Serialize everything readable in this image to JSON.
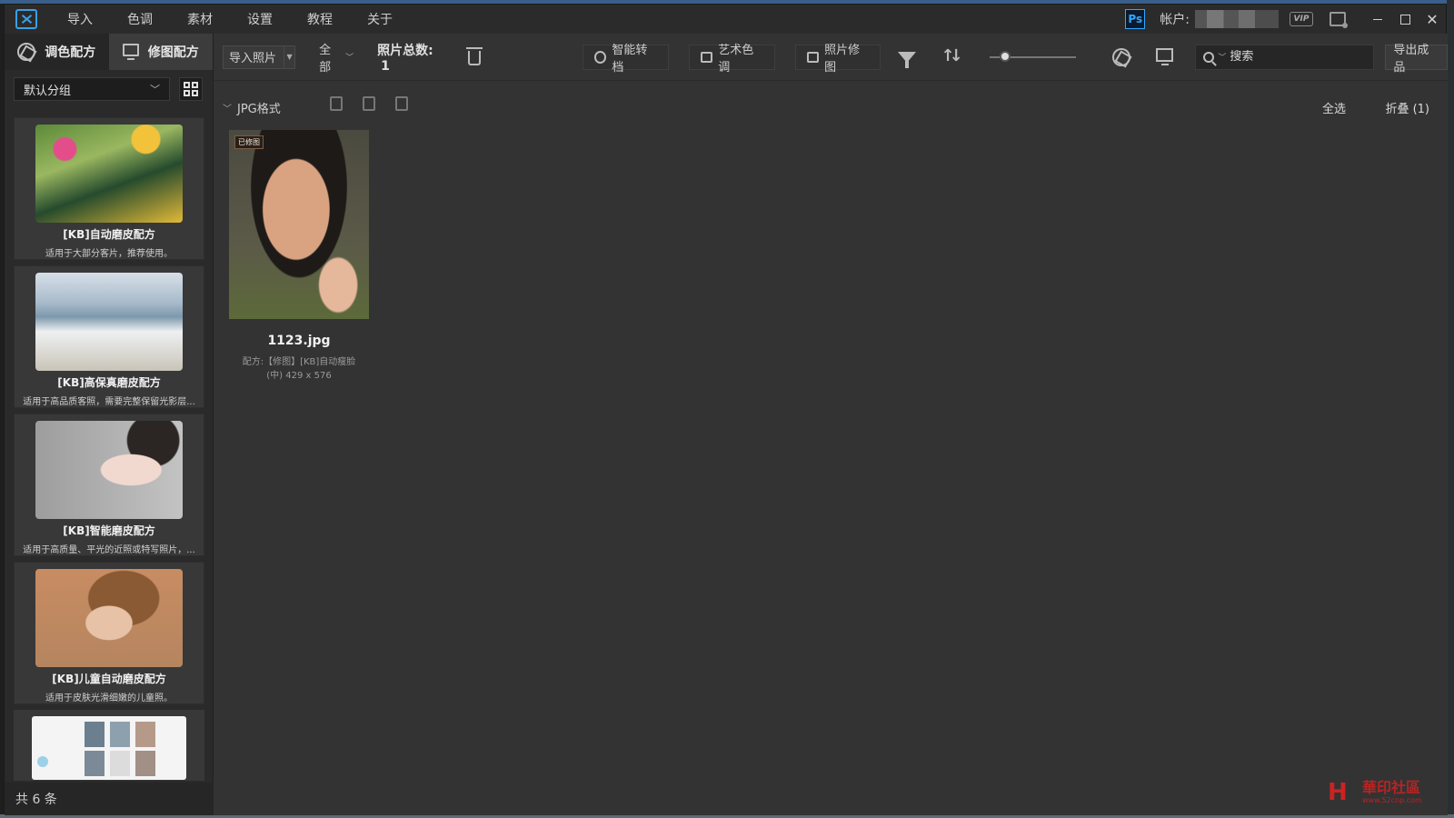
{
  "menu": [
    "导入",
    "色调",
    "素材",
    "设置",
    "教程",
    "关于"
  ],
  "titlebar": {
    "ps_label": "Ps",
    "account_label": "帐户:",
    "vip_label": "VIP"
  },
  "left_panel": {
    "tabs": [
      {
        "label": "调色配方",
        "icon": "aperture-icon"
      },
      {
        "label": "修图配方",
        "icon": "monitor-icon"
      }
    ],
    "group_select": "默认分组",
    "presets": [
      {
        "name": "[KB]自动磨皮配方",
        "desc": "适用于大部分客片，推荐使用。"
      },
      {
        "name": "[KB]高保真磨皮配方",
        "desc": "适用于高品质客照，需要完整保留光影层..."
      },
      {
        "name": "[KB]智能磨皮配方",
        "desc": "适用于高质量、平光的近照或特写照片，..."
      },
      {
        "name": "[KB]儿童自动磨皮配方",
        "desc": "适用于皮肤光滑细嫩的儿童照。"
      }
    ],
    "footer": "共 6 条"
  },
  "toolbar": {
    "import_label": "导入照片",
    "filter_all": "全部",
    "photo_total_label": "照片总数:",
    "photo_total": "1",
    "actions": [
      "智能转档",
      "艺术色调",
      "照片修图"
    ],
    "zoom_level": 0.12,
    "search_placeholder": "搜索",
    "export_label": "导出成品"
  },
  "main": {
    "group_title": "JPG格式",
    "select_all": "全选",
    "collapse": "折叠 (1)",
    "photo": {
      "badge": "已修图",
      "name": "1123.jpg",
      "meta_line1": "配方:【修图】[KB]自动瘦脸",
      "meta_line2": "(中)   429 x 576"
    }
  },
  "watermark": {
    "logo_char": "H",
    "text": "華印社區",
    "url": "www.52cnp.com"
  },
  "colors": {
    "window_bg": "#333333",
    "sidebar_bg": "#2a2a2a",
    "accent": "#3ba0e6",
    "ps_blue": "#31a8ff"
  }
}
